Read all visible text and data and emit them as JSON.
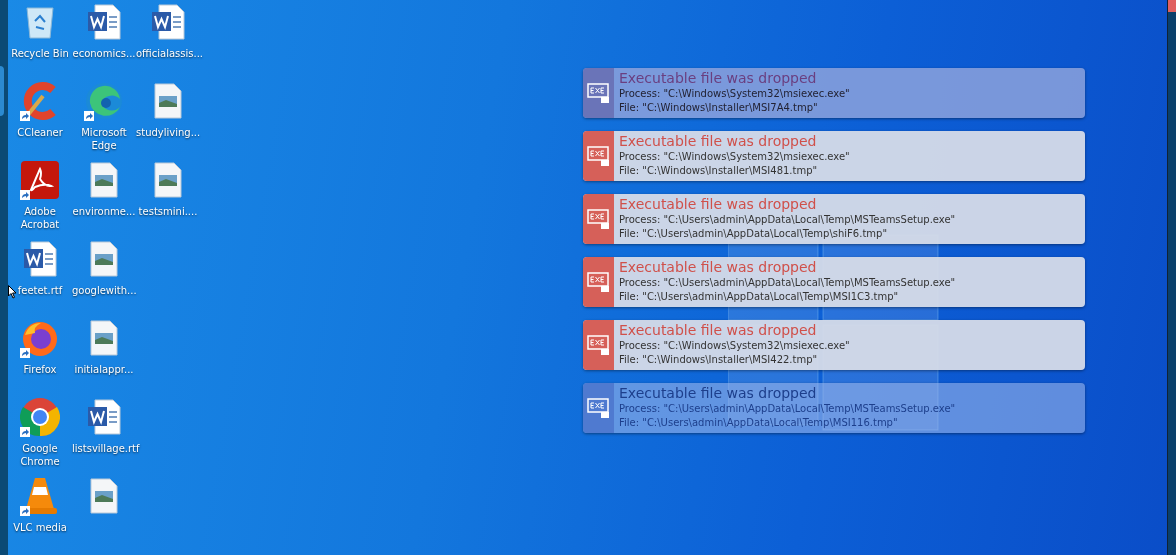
{
  "desktop_icons": [
    [
      {
        "label": "Recycle Bin",
        "kind": "recycle",
        "shortcut": false
      },
      {
        "label": "economics...",
        "kind": "word",
        "shortcut": false
      },
      {
        "label": "officialassis...",
        "kind": "word",
        "shortcut": false
      }
    ],
    [
      {
        "label": "CCleaner",
        "kind": "ccleaner",
        "shortcut": true
      },
      {
        "label": "Microsoft Edge",
        "kind": "edge",
        "shortcut": true
      },
      {
        "label": "studyliving...",
        "kind": "image",
        "shortcut": false
      }
    ],
    [
      {
        "label": "Adobe Acrobat",
        "kind": "acrobat",
        "shortcut": true
      },
      {
        "label": "environme...",
        "kind": "image",
        "shortcut": false
      },
      {
        "label": "testsmini....",
        "kind": "image",
        "shortcut": false
      }
    ],
    [
      {
        "label": "feetet.rtf",
        "kind": "word",
        "shortcut": false
      },
      {
        "label": "googlewith...",
        "kind": "image",
        "shortcut": false
      }
    ],
    [
      {
        "label": "Firefox",
        "kind": "firefox",
        "shortcut": true
      },
      {
        "label": "initialappr...",
        "kind": "image",
        "shortcut": false
      }
    ],
    [
      {
        "label": "Google Chrome",
        "kind": "chrome",
        "shortcut": true
      },
      {
        "label": "listsvillage.rtf",
        "kind": "word",
        "shortcut": false
      }
    ],
    [
      {
        "label": "VLC media",
        "kind": "vlc",
        "shortcut": true
      },
      {
        "kind": "image",
        "shortcut": false
      }
    ]
  ],
  "notifications": [
    {
      "kind": "fading",
      "title": "Executable file was dropped",
      "process": "Process: \"C:\\Windows\\System32\\msiexec.exe\"",
      "file": "File: \"C:\\Windows\\Installer\\MSI7A4.tmp\""
    },
    {
      "kind": "solid",
      "title": "Executable file was dropped",
      "process": "Process: \"C:\\Windows\\System32\\msiexec.exe\"",
      "file": "File: \"C:\\Windows\\Installer\\MSI481.tmp\""
    },
    {
      "kind": "solid",
      "title": "Executable file was dropped",
      "process": "Process: \"C:\\Users\\admin\\AppData\\Local\\Temp\\MSTeamsSetup.exe\"",
      "file": "File: \"C:\\Users\\admin\\AppData\\Local\\Temp\\shiF6.tmp\""
    },
    {
      "kind": "solid",
      "title": "Executable file was dropped",
      "process": "Process: \"C:\\Users\\admin\\AppData\\Local\\Temp\\MSTeamsSetup.exe\"",
      "file": "File: \"C:\\Users\\admin\\AppData\\Local\\Temp\\MSI1C3.tmp\""
    },
    {
      "kind": "solid",
      "title": "Executable file was dropped",
      "process": "Process: \"C:\\Windows\\System32\\msiexec.exe\"",
      "file": "File: \"C:\\Windows\\Installer\\MSI422.tmp\""
    },
    {
      "kind": "ghost",
      "title": "Executable file was dropped",
      "process": "Process: \"C:\\Users\\admin\\AppData\\Local\\Temp\\MSTeamsSetup.exe\"",
      "file": "File: \"C:\\Users\\admin\\AppData\\Local\\Temp\\MSI116.tmp\""
    }
  ]
}
